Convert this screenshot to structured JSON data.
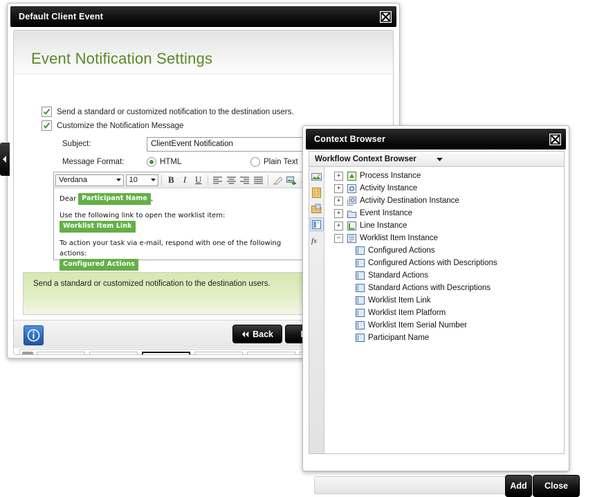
{
  "wizard": {
    "window_title": "Default Client Event",
    "close_icon": "close-icon",
    "heading": "Event Notification Settings",
    "checkboxes": [
      {
        "label": "Send a standard or customized notification to the destination users.",
        "checked": true
      },
      {
        "label": "Customize the Notification Message",
        "checked": true
      }
    ],
    "subject": {
      "label": "Subject:",
      "value": "ClientEvent Notification",
      "placeholder": "",
      "browse_label": "..."
    },
    "message_format": {
      "label": "Message Format:",
      "options": [
        {
          "label": "HTML",
          "selected": true
        },
        {
          "label": "Plain Text",
          "selected": false
        }
      ]
    },
    "editor": {
      "font_family": "Verdana",
      "font_size": "10",
      "buttons": [
        "B",
        "I",
        "U"
      ],
      "tool_icons": [
        "bold-icon",
        "italic-icon",
        "underline-icon",
        "align-left-icon",
        "align-center-icon",
        "align-right-icon",
        "align-justify-icon",
        "eraser-icon",
        "insert-image-icon"
      ],
      "content": {
        "greeting_prefix": "Dear ",
        "greeting_token": "Participant Name",
        "greeting_suffix": ",",
        "line_link_text": "Use the following link to open the worklist item:",
        "link_token": "Worklist Item Link",
        "line_action_text": "To action your task via e-mail, respond with one of the following actions:",
        "action_token": "Configured Actions"
      }
    },
    "hint_text": "Send a standard or customized notification to the destination users.",
    "footer": {
      "info_icon": "info-icon",
      "back_label": "Back",
      "next_label": "Next"
    },
    "filmstrip": {
      "prev_icon": "chevron-left-icon",
      "collapse_icon": "chevron-up-icon",
      "selected_index": 2,
      "count": 6
    },
    "flyout_icon": "chevron-left-icon"
  },
  "context_browser": {
    "window_title": "Context Browser",
    "close_icon": "close-icon",
    "header": {
      "label": "Workflow Context Browser",
      "chevron_icon": "chevron-down-icon"
    },
    "rail": [
      {
        "name": "environment-icon",
        "active": false
      },
      {
        "name": "smartobject-icon",
        "active": false
      },
      {
        "name": "workflow-context-icon",
        "active": false
      },
      {
        "name": "context-browser-icon",
        "active": true
      },
      {
        "name": "function-fx-icon",
        "active": false
      }
    ],
    "tree": [
      {
        "label": "Process Instance",
        "state": "collapsed",
        "depth": 0,
        "icon": "process-instance-icon"
      },
      {
        "label": "Activity Instance",
        "state": "collapsed",
        "depth": 0,
        "icon": "activity-instance-icon"
      },
      {
        "label": "Activity Destination Instance",
        "state": "collapsed",
        "depth": 0,
        "icon": "activity-destination-icon"
      },
      {
        "label": "Event Instance",
        "state": "collapsed",
        "depth": 0,
        "icon": "event-instance-icon"
      },
      {
        "label": "Line Instance",
        "state": "collapsed",
        "depth": 0,
        "icon": "line-instance-icon"
      },
      {
        "label": "Worklist Item Instance",
        "state": "expanded",
        "depth": 0,
        "icon": "worklist-item-instance-icon"
      },
      {
        "label": "Configured Actions",
        "state": "leaf",
        "depth": 1,
        "icon": "field-icon"
      },
      {
        "label": "Configured Actions with Descriptions",
        "state": "leaf",
        "depth": 1,
        "icon": "field-icon"
      },
      {
        "label": "Standard Actions",
        "state": "leaf",
        "depth": 1,
        "icon": "field-icon"
      },
      {
        "label": "Standard Actions with Descriptions",
        "state": "leaf",
        "depth": 1,
        "icon": "field-icon"
      },
      {
        "label": "Worklist Item Link",
        "state": "leaf",
        "depth": 1,
        "icon": "field-icon"
      },
      {
        "label": "Worklist Item Platform",
        "state": "leaf",
        "depth": 1,
        "icon": "field-icon"
      },
      {
        "label": "Worklist Item Serial Number",
        "state": "leaf",
        "depth": 1,
        "icon": "field-icon"
      },
      {
        "label": "Participant Name",
        "state": "leaf",
        "depth": 1,
        "icon": "field-icon"
      }
    ],
    "buttons": {
      "add_label": "Add",
      "close_label": "Close"
    }
  },
  "colors": {
    "heading_green": "#5c8727",
    "token_green": "#63b046",
    "hint_green": "#d6e7b0",
    "titlebar_black": "#000000",
    "accent_blue": "#2f6fc4"
  }
}
